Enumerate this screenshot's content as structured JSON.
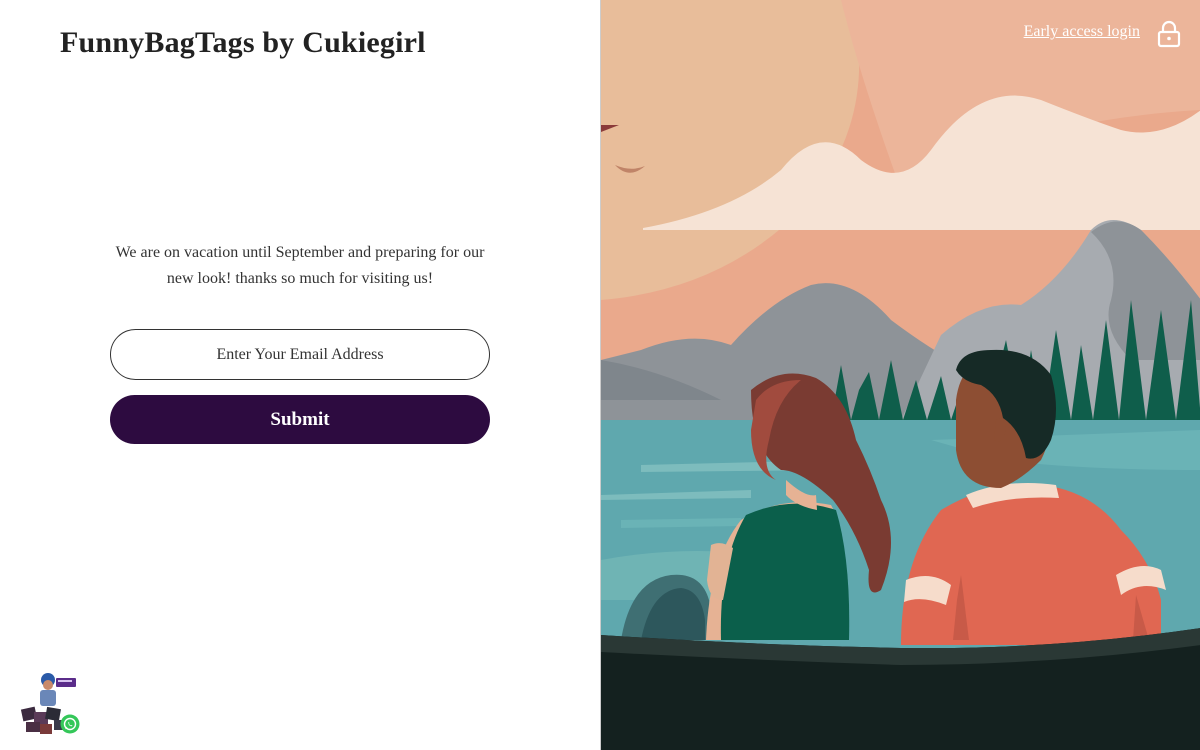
{
  "store": {
    "title": "FunnyBagTags by Cukiegirl"
  },
  "message": {
    "line1": "We are on vacation until September and preparing for our",
    "line2": "new look! thanks so much for visiting us!"
  },
  "form": {
    "email_placeholder": "Enter Your Email Address",
    "submit_label": "Submit"
  },
  "header_right": {
    "login_label": "Early access login",
    "lock_icon": "lock-icon"
  },
  "chat_widget": {
    "icon": "whatsapp-icon"
  },
  "colors": {
    "submit_bg": "#2d0b40",
    "sky": "#eaa98c",
    "water": "#5fa8ae",
    "forest": "#0f5e4b"
  }
}
